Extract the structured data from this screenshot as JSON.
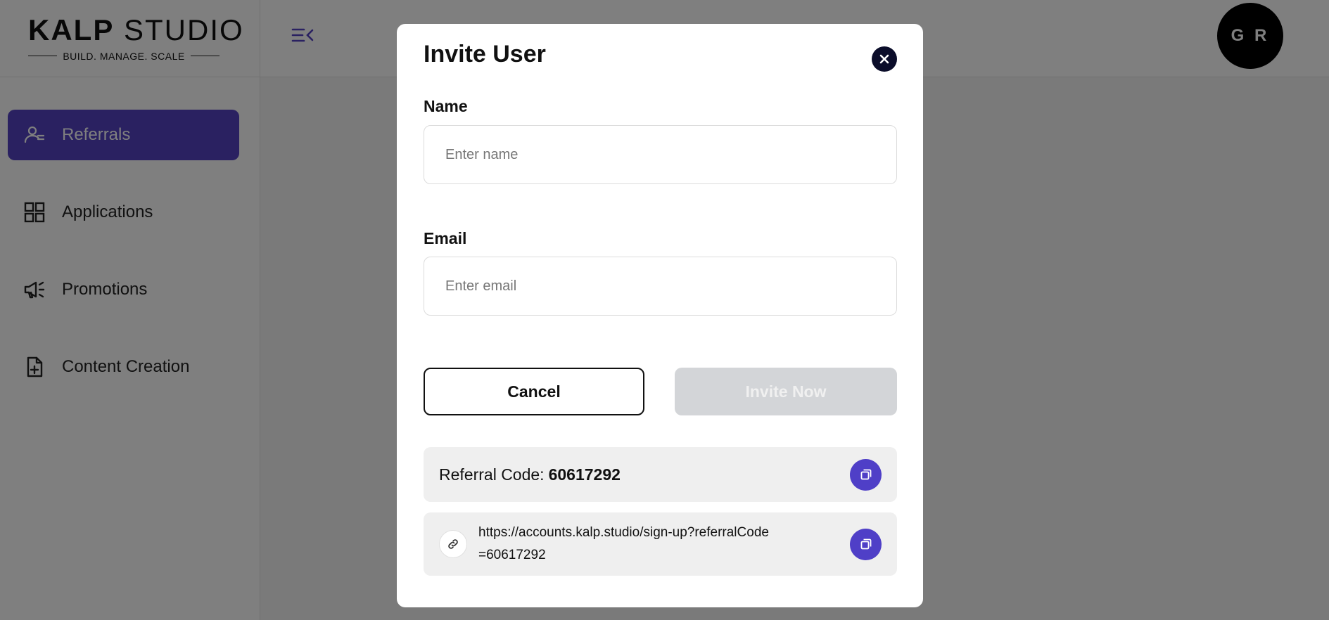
{
  "brand": {
    "name_bold": "KALP",
    "name_regular": "STUDIO",
    "tagline": "BUILD. MANAGE. SCALE"
  },
  "sidebar": {
    "items": [
      {
        "label": "Referrals",
        "icon": "referrals-icon",
        "active": true
      },
      {
        "label": "Applications",
        "icon": "grid-icon",
        "active": false
      },
      {
        "label": "Promotions",
        "icon": "megaphone-icon",
        "active": false
      },
      {
        "label": "Content Creation",
        "icon": "file-plus-icon",
        "active": false
      }
    ]
  },
  "header": {
    "avatar_initials": "G R"
  },
  "modal": {
    "title": "Invite User",
    "name_label": "Name",
    "name_placeholder": "Enter name",
    "name_value": "",
    "email_label": "Email",
    "email_placeholder": "Enter email",
    "email_value": "",
    "cancel_label": "Cancel",
    "invite_label": "Invite Now",
    "referral_code_label": "Referral Code:",
    "referral_code": "60617292",
    "referral_link": "https://accounts.kalp.studio/sign-up?referralCode=60617292"
  },
  "colors": {
    "accent": "#5443c3",
    "copy_button": "#4f3fc7",
    "close_button": "#0b0d2a",
    "disabled_button": "#d3d5d8"
  }
}
